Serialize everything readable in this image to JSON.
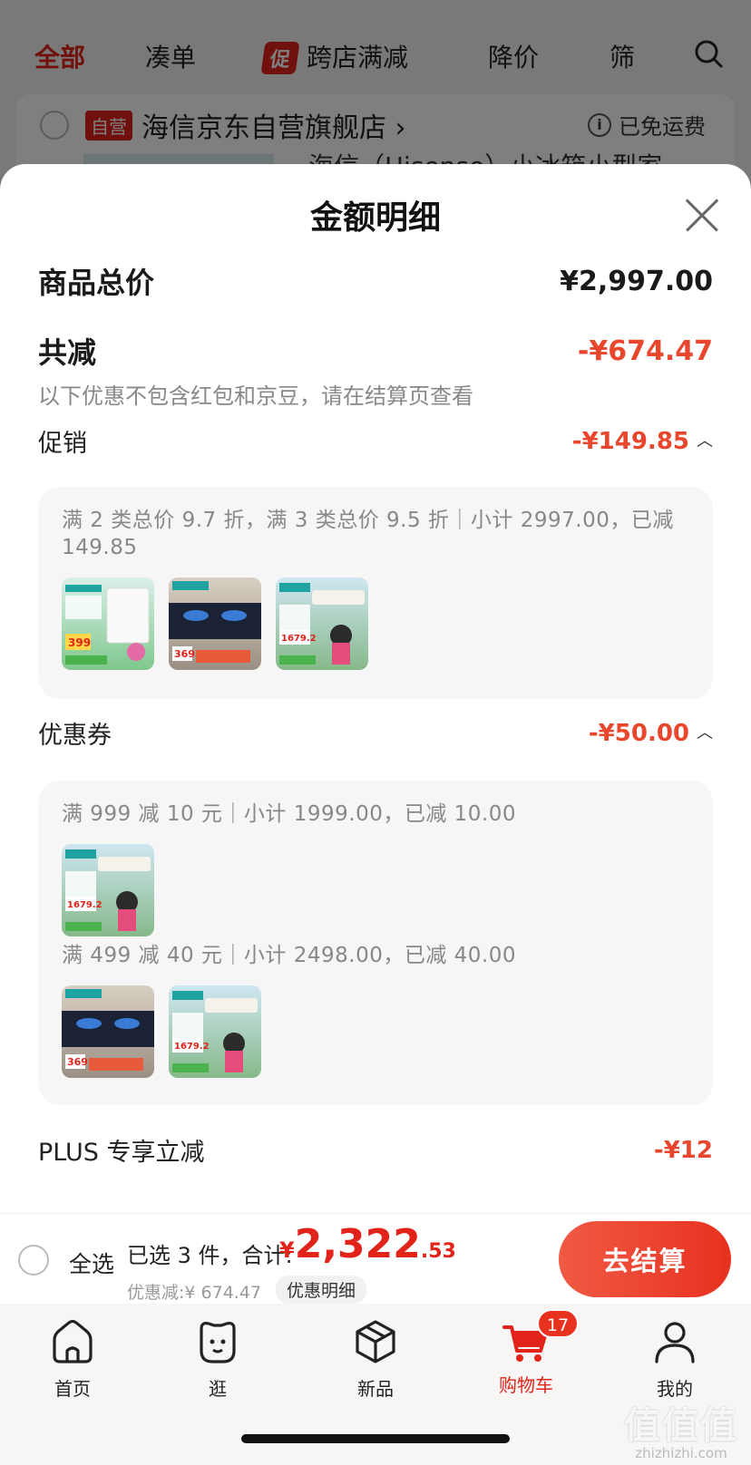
{
  "background": {
    "tabs": [
      "全部",
      "凑单",
      "跨店满减",
      "降价",
      "筛"
    ],
    "promo_badge": "促",
    "store_badge": "自营",
    "store_name": "海信京东自营旗舰店 ›",
    "shipping": "已免运费",
    "product_name": "海信（Hisense）小冰箱小型家"
  },
  "sheet": {
    "title": "金额明细",
    "total_label": "商品总价",
    "total_amount": "¥2,997.00",
    "discount_label": "共减",
    "discount_amount": "-¥674.47",
    "note": "以下优惠不包含红包和京豆，请在结算页查看",
    "promotion": {
      "label": "促销",
      "amount": "-¥149.85",
      "rule": "满 2 类总价 9.7 折，满 3 类总价 9.5 折｜小计 2997.00，已减 149.85",
      "thumbs": [
        "fridge-399",
        "gas-stove-369",
        "aircon-1679.2"
      ]
    },
    "coupon": {
      "label": "优惠券",
      "amount": "-¥50.00",
      "rule1": "满 999 减 10 元｜小计 1999.00，已减 10.00",
      "thumbs1": [
        "aircon-1679.2"
      ],
      "rule2": "满 499 减 40 元｜小计 2498.00，已减 40.00",
      "thumbs2": [
        "gas-stove-369",
        "aircon-1679.2"
      ]
    },
    "plus": {
      "label": "PLUS 专享立减",
      "amount": "-¥12"
    },
    "thumb_prices": {
      "fridge": "399",
      "stove": "369",
      "aircon": "1679.2"
    }
  },
  "checkout": {
    "select_all": "全选",
    "selected": "已选 3 件，合计:",
    "currency": "¥",
    "price_int": "2,322",
    "price_dec": ".53",
    "saved": "优惠减:¥ 674.47",
    "detail": "优惠明细",
    "button": "去结算"
  },
  "tabbar": {
    "home": "首页",
    "browse": "逛",
    "new": "新品",
    "cart": "购物车",
    "cart_badge": "17",
    "mine": "我的"
  },
  "watermark": {
    "logo": "值值值",
    "url": "zhizhizhi.com"
  },
  "colors": {
    "accent": "#e2231a",
    "discount": "#e8472e"
  }
}
